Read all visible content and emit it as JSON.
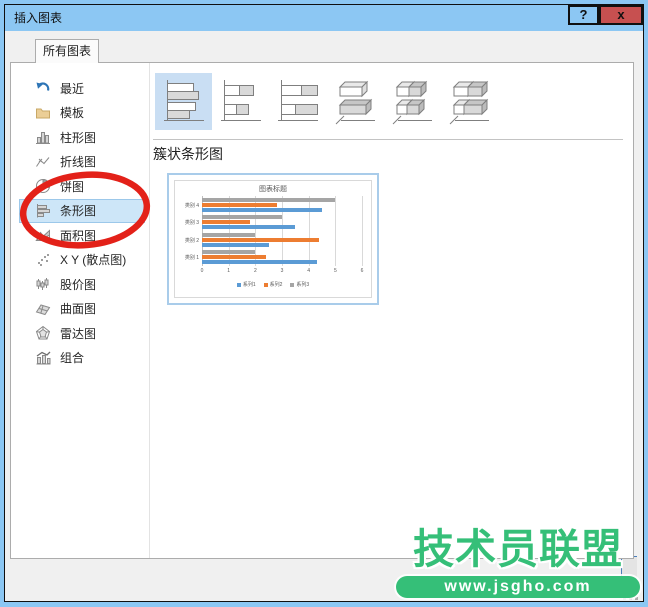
{
  "window": {
    "title": "插入图表",
    "help_label": "?",
    "close_label": "x"
  },
  "tabs": [
    {
      "label": "所有图表",
      "selected": true
    }
  ],
  "sidebar": {
    "items": [
      {
        "icon": "recent-icon",
        "label": "最近"
      },
      {
        "icon": "template-icon",
        "label": "模板"
      },
      {
        "icon": "column-chart-icon",
        "label": "柱形图"
      },
      {
        "icon": "line-chart-icon",
        "label": "折线图"
      },
      {
        "icon": "pie-chart-icon",
        "label": "饼图"
      },
      {
        "icon": "bar-chart-icon",
        "label": "条形图",
        "selected": true,
        "annotated": true
      },
      {
        "icon": "area-chart-icon",
        "label": "面积图"
      },
      {
        "icon": "scatter-chart-icon",
        "label": "X Y (散点图)"
      },
      {
        "icon": "stock-chart-icon",
        "label": "股价图"
      },
      {
        "icon": "surface-chart-icon",
        "label": "曲面图"
      },
      {
        "icon": "radar-chart-icon",
        "label": "雷达图"
      },
      {
        "icon": "combo-chart-icon",
        "label": "组合"
      }
    ]
  },
  "subtypes": {
    "items": [
      {
        "name": "clustered-bar-icon",
        "selected": true
      },
      {
        "name": "stacked-bar-icon",
        "selected": false
      },
      {
        "name": "pct-stacked-bar-icon",
        "selected": false
      },
      {
        "name": "clustered-bar-3d-icon",
        "selected": false
      },
      {
        "name": "stacked-bar-3d-icon",
        "selected": false
      },
      {
        "name": "pct-stacked-bar-3d-icon",
        "selected": false
      }
    ]
  },
  "section": {
    "heading": "簇状条形图"
  },
  "chart_data": {
    "type": "bar",
    "title": "图表标题",
    "categories": [
      "类别 1",
      "类别 2",
      "类别 3",
      "类别 4"
    ],
    "series": [
      {
        "name": "系列1",
        "color": "#5B9BD5",
        "values": [
          4.3,
          2.5,
          3.5,
          4.5
        ]
      },
      {
        "name": "系列2",
        "color": "#ED7D31",
        "values": [
          2.4,
          4.4,
          1.8,
          2.8
        ]
      },
      {
        "name": "系列3",
        "color": "#A5A5A5",
        "values": [
          2,
          2,
          3,
          5
        ]
      }
    ],
    "xlim": [
      0,
      6
    ],
    "x_ticks": [
      0,
      1,
      2,
      3,
      4,
      5,
      6
    ],
    "grid": true,
    "legend_position": "bottom"
  },
  "watermark": {
    "title": "技术员联盟",
    "url": "www.jsgho.com"
  },
  "colors": {
    "titlebar_blue": "#8CC7F3",
    "close_button_red": "#C75050",
    "selection_blue": "#CDE6F8",
    "annotation_red": "#E32119",
    "watermark_green": "#35BF78"
  }
}
